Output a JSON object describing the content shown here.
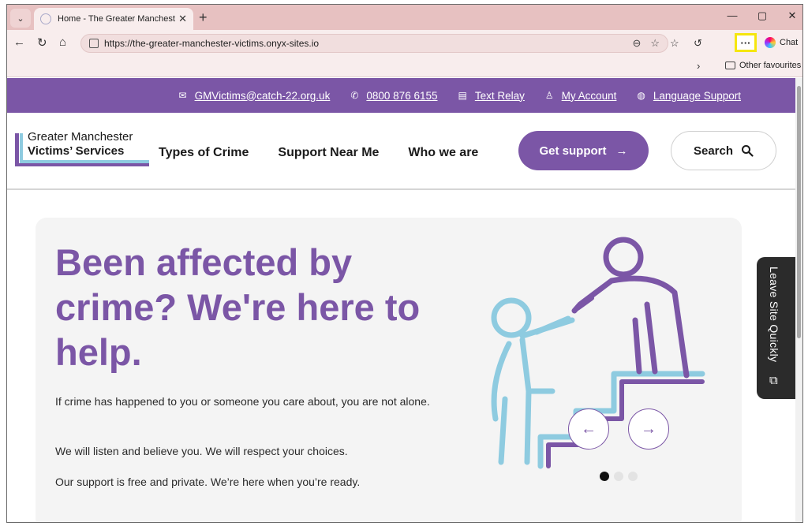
{
  "browser": {
    "tab": {
      "title": "Home - The Greater Manchester V",
      "close": "✕"
    },
    "tab_menu_icon": "chevron-down-icon",
    "new_tab": "+",
    "window_controls": {
      "minimize": "—",
      "maximize": "▢",
      "close": "✕"
    },
    "url": "https://the-greater-manchester-victims.onyx-sites.io",
    "more_button": "···",
    "chat_label": "Chat",
    "favourites": {
      "chevron": "›",
      "other_label": "Other favourites"
    }
  },
  "utility_bar": {
    "email": "GMVictims@catch-22.org.uk",
    "phone": "0800 876 6155",
    "text_relay": "Text Relay",
    "my_account": "My Account",
    "language_support": "Language Support"
  },
  "logo": {
    "line1": "Greater Manchester",
    "line2": "Victims’ Services"
  },
  "nav": {
    "types_of_crime": "Types of Crime",
    "support_near_me": "Support Near Me",
    "who_we_are": "Who we are"
  },
  "buttons": {
    "get_support": "Get support",
    "search": "Search"
  },
  "hero": {
    "heading": "Been affected by crime? We're here to help.",
    "p1": "If crime has happened to you or someone you care about, you are not alone.",
    "p2": "We will listen and believe you. We will respect your choices.",
    "p3": "Our support is free and private. We’re here when you’re ready."
  },
  "carousel": {
    "prev": "←",
    "next": "→",
    "slide_count": 3,
    "active_slide": 1
  },
  "leave_site": {
    "label": "Leave Site Quickly",
    "icon": "external-link-icon"
  },
  "colors": {
    "brand_purple": "#7b56a6",
    "brand_blue": "#8ecbe0",
    "browser_chrome": "#e7c1c1",
    "highlight": "#f5e60f"
  }
}
